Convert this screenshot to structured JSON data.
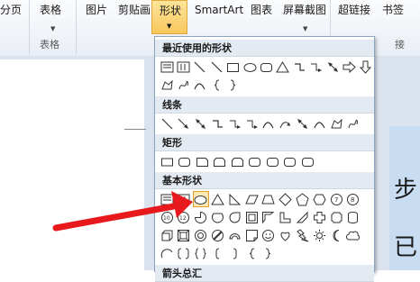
{
  "ribbon": {
    "partial_tab": "分页",
    "table": "表格",
    "table_group": "表格",
    "picture": "图片",
    "clipart": "剪贴画",
    "shapes": "形状",
    "smartart": "SmartArt",
    "chart": "图表",
    "screenshot": "屏幕截图",
    "hyperlink": "超链接",
    "bookmark": "书签",
    "partial_group_right": "接"
  },
  "shapes_menu": {
    "sections": {
      "recent": "最近使用的形状",
      "lines": "线条",
      "rectangles": "矩形",
      "basic": "基本形状",
      "block_arrows": "箭头总汇"
    },
    "selected_shape": "oval-shape"
  },
  "document": {
    "char1": "步",
    "char2": "已"
  },
  "colors": {
    "accent_highlight": "#f8c75d",
    "arrow": "#e8191c",
    "header_bg": "#e4eaf2"
  }
}
